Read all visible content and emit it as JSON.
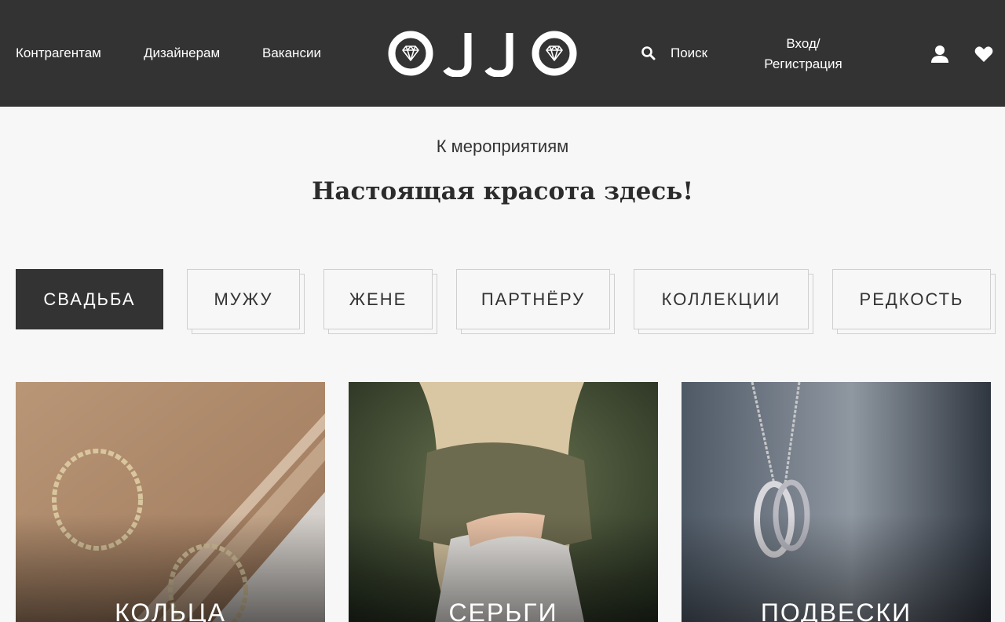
{
  "header": {
    "nav": [
      "Контрагентам",
      "Дизайнерам",
      "Вакансии"
    ],
    "logo_text": "OJJO",
    "search_label": "Поиск",
    "login_line1": "Вход/",
    "login_line2": "Регистрация",
    "icons": [
      "search-icon",
      "user-icon",
      "heart-icon"
    ]
  },
  "main": {
    "back_link": "К мероприятиям",
    "headline": "Настоящая красота здесь!",
    "tabs": [
      "СВАДЬБА",
      "МУЖУ",
      "ЖЕНЕ",
      "ПАРТНЁРУ",
      "КОЛЛЕКЦИИ",
      "РЕДКОСТЬ"
    ],
    "active_tab": "СВАДЬБА",
    "cards": [
      "КОЛЬЦА",
      "СЕРЬГИ",
      "ПОДВЕСКИ"
    ]
  },
  "colors": {
    "header_bg": "#333333",
    "page_bg": "#f7f7f7",
    "accent": "#333333"
  }
}
